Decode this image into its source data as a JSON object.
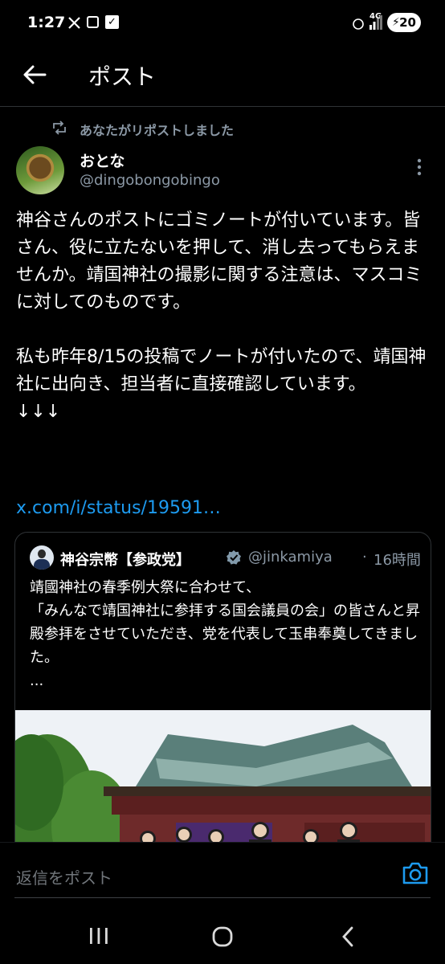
{
  "status_bar": {
    "time": "1:27",
    "network": "4G",
    "battery": "20",
    "icons": [
      "x-logo-icon",
      "screenshot-icon",
      "checkbox-icon",
      "alarm-off-icon",
      "signal-icon",
      "charging-icon"
    ]
  },
  "header": {
    "back_icon": "arrow-left-icon",
    "title": "ポスト"
  },
  "repost": {
    "label": "あなたがリポストしました"
  },
  "author": {
    "name": "おとな",
    "handle": "@dingobongobingo"
  },
  "post": {
    "paragraph1": "神谷さんのポストにゴミノートが付いています。皆さん、役に立たないを押して、消し去ってもらえませんか。靖国神社の撮影に関する注意は、マスコミに対してのものです。",
    "paragraph2": "私も昨年8/15の投稿でノートが付いたので、靖国神社に出向き、担当者に直接確認しています。",
    "arrows": "↓↓↓",
    "link": "x.com/i/status/19591…"
  },
  "quote": {
    "name": "神谷宗幣【参政党】",
    "handle": "@jinkamiya",
    "separator": "·",
    "time": "16時間",
    "line1": "靖國神社の春季例大祭に合わせて、",
    "line2": "「みんなで靖国神社に参拝する国会議員の会」の皆さんと昇殿参拝をさせていただき、党を代表して玉串奉奠してきました。",
    "ellipsis": "..."
  },
  "reply": {
    "placeholder": "返信をポスト"
  },
  "colors": {
    "accent": "#1d9bf0",
    "background": "#000000",
    "secondary_text": "#8b98a5"
  }
}
